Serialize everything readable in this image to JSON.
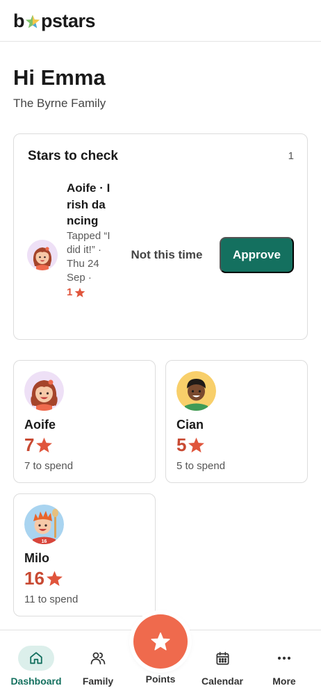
{
  "header": {
    "logo_left": "b",
    "logo_right": "pstars",
    "logo_icon": "star-logo-icon"
  },
  "greeting": {
    "title": "Hi Emma",
    "family": "The Byrne Family"
  },
  "stars_to_check": {
    "title": "Stars to check",
    "count": "1",
    "item": {
      "child": "Aoife",
      "title": "Aoife · Irish dancing",
      "subtitle": "Tapped “I did it!” · Thu 24 Sep ·",
      "stars": "1",
      "star_icon": "star-icon"
    },
    "reject_label": "Not this time",
    "approve_label": "Approve"
  },
  "children": [
    {
      "name": "Aoife",
      "points": "7",
      "spend": "7 to spend",
      "avatar": "girl-avatar-icon"
    },
    {
      "name": "Cian",
      "points": "5",
      "spend": "5 to spend",
      "avatar": "boy-avatar-icon"
    },
    {
      "name": "Milo",
      "points": "16",
      "spend": "11 to spend",
      "avatar": "boy-avatar-icon"
    }
  ],
  "nav": {
    "items": [
      {
        "label": "Dashboard",
        "icon": "home-icon",
        "active": true
      },
      {
        "label": "Family",
        "icon": "people-icon",
        "active": false
      },
      {
        "label": "Points",
        "icon": "star-icon",
        "active": false
      },
      {
        "label": "Calendar",
        "icon": "calendar-icon",
        "active": false
      },
      {
        "label": "More",
        "icon": "more-icon",
        "active": false
      }
    ]
  },
  "colors": {
    "accent": "#14705f",
    "star": "#e0553c",
    "points": "#c84a33",
    "fab": "#ef6a4d",
    "active_nav_bg": "#dcefeb"
  }
}
